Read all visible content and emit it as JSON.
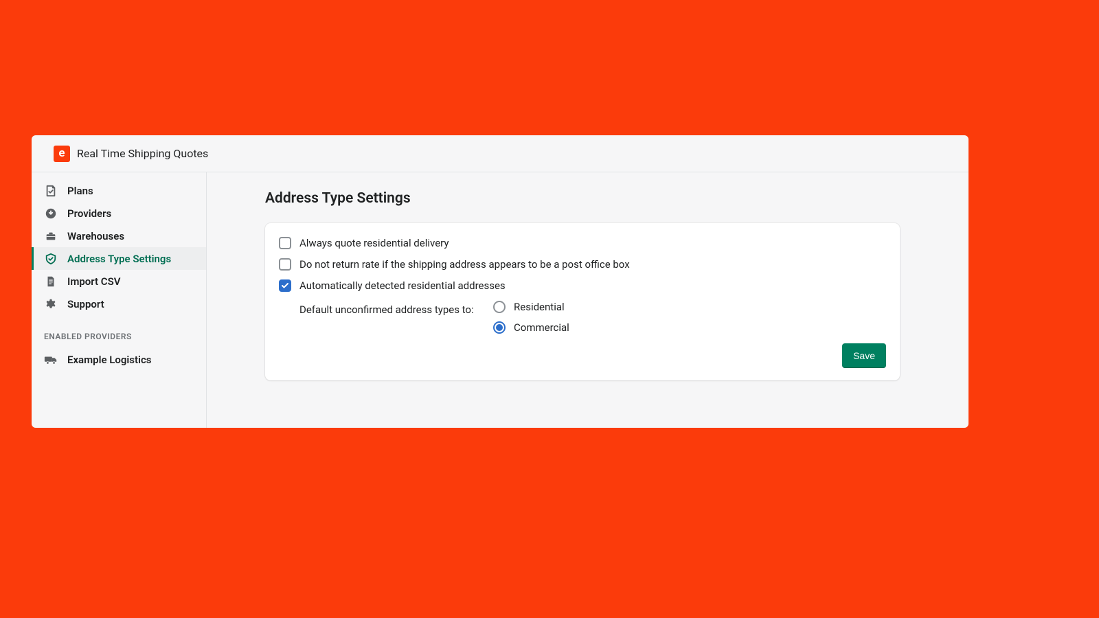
{
  "header": {
    "logo_letter": "e",
    "title": "Real Time Shipping Quotes"
  },
  "sidebar": {
    "items": [
      {
        "label": "Plans"
      },
      {
        "label": "Providers"
      },
      {
        "label": "Warehouses"
      },
      {
        "label": "Address Type Settings"
      },
      {
        "label": "Import CSV"
      },
      {
        "label": "Support"
      }
    ],
    "providers_header": "ENABLED PROVIDERS",
    "providers": [
      {
        "label": "Example Logistics"
      }
    ]
  },
  "main": {
    "title": "Address Type Settings",
    "checkboxes": {
      "always_quote": "Always quote residential delivery",
      "no_po_box": "Do not return rate if the shipping address appears to be a post office box",
      "auto_detect": "Automatically detected residential addresses"
    },
    "default_label": "Default unconfirmed address types to:",
    "radio_residential": "Residential",
    "radio_commercial": "Commercial",
    "save_label": "Save"
  }
}
